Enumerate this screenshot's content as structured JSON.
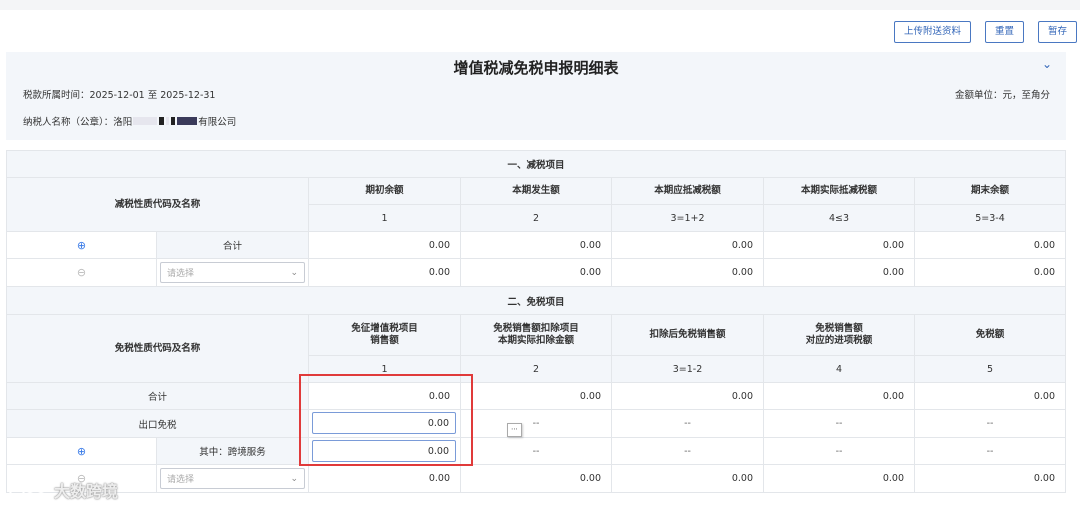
{
  "toolbar": {
    "upload_label": "上传附送资料",
    "reset_label": "重置",
    "save_label": "暂存"
  },
  "header": {
    "title": "增值税减免税申报明细表",
    "period": "税款所属时间：2025-12-01 至 2025-12-31",
    "unit": "金额单位：元，至角分",
    "taxpayer_prefix": "纳税人名称（公章）：洛阳",
    "taxpayer_suffix": "有限公司"
  },
  "section1": {
    "title": "一、减税项目",
    "name_header": "减税性质代码及名称",
    "columns": [
      {
        "label": "期初余额",
        "index": "1"
      },
      {
        "label": "本期发生额",
        "index": "2"
      },
      {
        "label": "本期应抵减税额",
        "index": "3=1+2"
      },
      {
        "label": "本期实际抵减税额",
        "index": "4≤3"
      },
      {
        "label": "期末余额",
        "index": "5=3-4"
      }
    ],
    "total_label": "合计",
    "total_values": [
      "0.00",
      "0.00",
      "0.00",
      "0.00",
      "0.00"
    ],
    "select_placeholder": "请选择",
    "row_values": [
      "0.00",
      "0.00",
      "0.00",
      "0.00",
      "0.00"
    ]
  },
  "section2": {
    "title": "二、免税项目",
    "name_header": "免税性质代码及名称",
    "columns": [
      {
        "label_line1": "免征增值税项目",
        "label_line2": "销售额",
        "index": "1"
      },
      {
        "label_line1": "免税销售额扣除项目",
        "label_line2": "本期实际扣除金额",
        "index": "2"
      },
      {
        "label_line1": "扣除后免税销售额",
        "label_line2": "",
        "index": "3=1-2"
      },
      {
        "label_line1": "免税销售额",
        "label_line2": "对应的进项税额",
        "index": "4"
      },
      {
        "label_line1": "免税额",
        "label_line2": "",
        "index": "5"
      }
    ],
    "total_label": "合计",
    "total_values": [
      "0.00",
      "0.00",
      "0.00",
      "0.00",
      "0.00"
    ],
    "export_label": "出口免税",
    "export_input": "0.00",
    "export_values": [
      "--",
      "--",
      "--",
      "--"
    ],
    "crossborder_label": "其中：跨境服务",
    "crossborder_input": "0.00",
    "crossborder_values": [
      "--",
      "--",
      "--",
      "--"
    ],
    "select_placeholder": "请选择",
    "row_values": [
      "0.00",
      "0.00",
      "0.00",
      "0.00",
      "0.00"
    ]
  },
  "watermark": {
    "text": "大数跨境"
  },
  "colors": {
    "accent": "#3366b8",
    "highlight": "#e03a3a",
    "header_bg": "#f3f6fa"
  }
}
